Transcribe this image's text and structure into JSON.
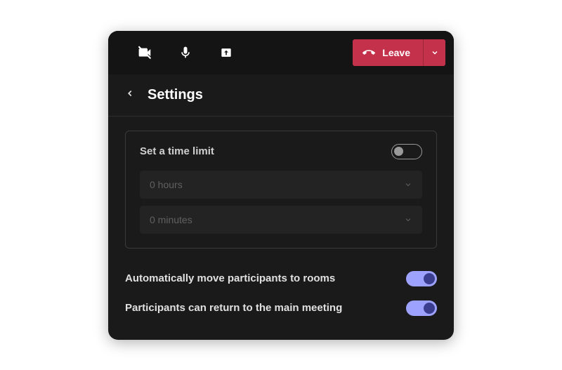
{
  "toolbar": {
    "leave_label": "Leave"
  },
  "panel": {
    "title": "Settings"
  },
  "time_limit": {
    "title": "Set a time limit",
    "enabled": false,
    "hours_label": "0 hours",
    "minutes_label": "0 minutes"
  },
  "settings": {
    "auto_move": {
      "label": "Automatically move participants to rooms",
      "enabled": true
    },
    "return_main": {
      "label": "Participants can return to the main meeting",
      "enabled": true
    }
  }
}
